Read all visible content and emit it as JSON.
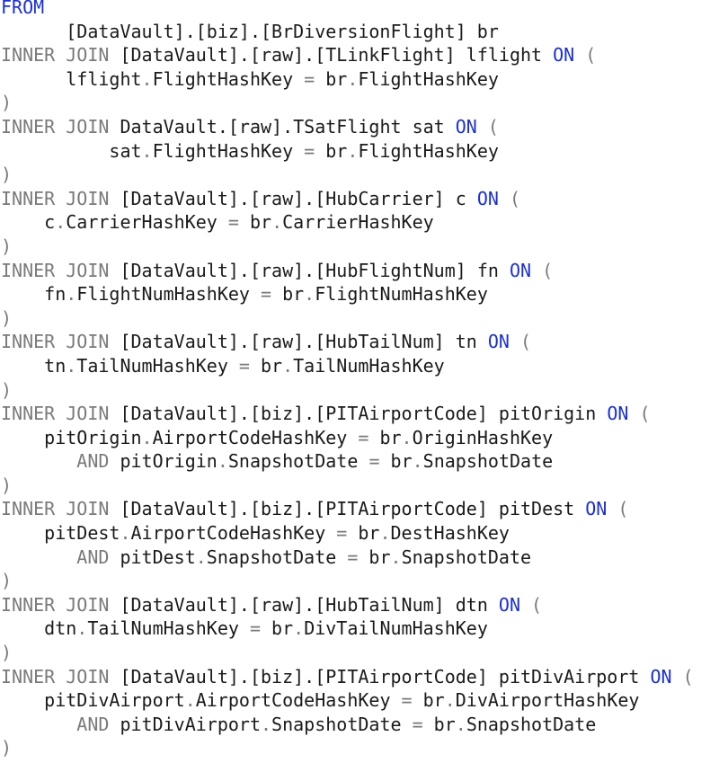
{
  "colors": {
    "keyword": "#1a2fd8",
    "join": "#7a7a7a",
    "operator": "#7a7a7a",
    "identifier": "#1a1a1a",
    "background": "#ffffff"
  },
  "code": {
    "lines": [
      [
        {
          "t": "FROM",
          "k": "keyword"
        }
      ],
      [
        {
          "t": "      [DataVault].[biz].[BrDiversionFlight] br",
          "k": "ident"
        }
      ],
      [
        {
          "t": "INNER JOIN",
          "k": "join"
        },
        {
          "t": " [DataVault].[raw].[TLinkFlight] lflight ",
          "k": "ident"
        },
        {
          "t": "ON",
          "k": "keyword"
        },
        {
          "t": " (",
          "k": "punct"
        }
      ],
      [
        {
          "t": "      lflight",
          "k": "ident"
        },
        {
          "t": ".",
          "k": "punct"
        },
        {
          "t": "FlightHashKey ",
          "k": "ident"
        },
        {
          "t": "=",
          "k": "operator"
        },
        {
          "t": " br",
          "k": "ident"
        },
        {
          "t": ".",
          "k": "punct"
        },
        {
          "t": "FlightHashKey",
          "k": "ident"
        }
      ],
      [
        {
          "t": ")",
          "k": "punct"
        }
      ],
      [
        {
          "t": "INNER JOIN",
          "k": "join"
        },
        {
          "t": " DataVault.[raw].TSatFlight sat ",
          "k": "ident"
        },
        {
          "t": "ON",
          "k": "keyword"
        },
        {
          "t": " (",
          "k": "punct"
        }
      ],
      [
        {
          "t": "          sat",
          "k": "ident"
        },
        {
          "t": ".",
          "k": "punct"
        },
        {
          "t": "FlightHashKey ",
          "k": "ident"
        },
        {
          "t": "=",
          "k": "operator"
        },
        {
          "t": " br",
          "k": "ident"
        },
        {
          "t": ".",
          "k": "punct"
        },
        {
          "t": "FlightHashKey",
          "k": "ident"
        }
      ],
      [
        {
          "t": ")",
          "k": "punct"
        }
      ],
      [
        {
          "t": "INNER JOIN",
          "k": "join"
        },
        {
          "t": " [DataVault].[raw].[HubCarrier] c ",
          "k": "ident"
        },
        {
          "t": "ON",
          "k": "keyword"
        },
        {
          "t": " (",
          "k": "punct"
        }
      ],
      [
        {
          "t": "    c",
          "k": "ident"
        },
        {
          "t": ".",
          "k": "punct"
        },
        {
          "t": "CarrierHashKey ",
          "k": "ident"
        },
        {
          "t": "=",
          "k": "operator"
        },
        {
          "t": " br",
          "k": "ident"
        },
        {
          "t": ".",
          "k": "punct"
        },
        {
          "t": "CarrierHashKey",
          "k": "ident"
        }
      ],
      [
        {
          "t": ")",
          "k": "punct"
        }
      ],
      [
        {
          "t": "INNER JOIN",
          "k": "join"
        },
        {
          "t": " [DataVault].[raw].[HubFlightNum] fn ",
          "k": "ident"
        },
        {
          "t": "ON",
          "k": "keyword"
        },
        {
          "t": " (",
          "k": "punct"
        }
      ],
      [
        {
          "t": "    fn",
          "k": "ident"
        },
        {
          "t": ".",
          "k": "punct"
        },
        {
          "t": "FlightNumHashKey ",
          "k": "ident"
        },
        {
          "t": "=",
          "k": "operator"
        },
        {
          "t": " br",
          "k": "ident"
        },
        {
          "t": ".",
          "k": "punct"
        },
        {
          "t": "FlightNumHashKey",
          "k": "ident"
        }
      ],
      [
        {
          "t": ")",
          "k": "punct"
        }
      ],
      [
        {
          "t": "INNER JOIN",
          "k": "join"
        },
        {
          "t": " [DataVault].[raw].[HubTailNum] tn ",
          "k": "ident"
        },
        {
          "t": "ON",
          "k": "keyword"
        },
        {
          "t": " (",
          "k": "punct"
        }
      ],
      [
        {
          "t": "    tn",
          "k": "ident"
        },
        {
          "t": ".",
          "k": "punct"
        },
        {
          "t": "TailNumHashKey ",
          "k": "ident"
        },
        {
          "t": "=",
          "k": "operator"
        },
        {
          "t": " br",
          "k": "ident"
        },
        {
          "t": ".",
          "k": "punct"
        },
        {
          "t": "TailNumHashKey",
          "k": "ident"
        }
      ],
      [
        {
          "t": ")",
          "k": "punct"
        }
      ],
      [
        {
          "t": "INNER JOIN",
          "k": "join"
        },
        {
          "t": " [DataVault].[biz].[PITAirportCode] pitOrigin ",
          "k": "ident"
        },
        {
          "t": "ON",
          "k": "keyword"
        },
        {
          "t": " (",
          "k": "punct"
        }
      ],
      [
        {
          "t": "    pitOrigin",
          "k": "ident"
        },
        {
          "t": ".",
          "k": "punct"
        },
        {
          "t": "AirportCodeHashKey ",
          "k": "ident"
        },
        {
          "t": "=",
          "k": "operator"
        },
        {
          "t": " br",
          "k": "ident"
        },
        {
          "t": ".",
          "k": "punct"
        },
        {
          "t": "OriginHashKey",
          "k": "ident"
        }
      ],
      [
        {
          "t": "       ",
          "k": "ident"
        },
        {
          "t": "AND",
          "k": "join"
        },
        {
          "t": " pitOrigin",
          "k": "ident"
        },
        {
          "t": ".",
          "k": "punct"
        },
        {
          "t": "SnapshotDate ",
          "k": "ident"
        },
        {
          "t": "=",
          "k": "operator"
        },
        {
          "t": " br",
          "k": "ident"
        },
        {
          "t": ".",
          "k": "punct"
        },
        {
          "t": "SnapshotDate",
          "k": "ident"
        }
      ],
      [
        {
          "t": ")",
          "k": "punct"
        }
      ],
      [
        {
          "t": "INNER JOIN",
          "k": "join"
        },
        {
          "t": " [DataVault].[biz].[PITAirportCode] pitDest ",
          "k": "ident"
        },
        {
          "t": "ON",
          "k": "keyword"
        },
        {
          "t": " (",
          "k": "punct"
        }
      ],
      [
        {
          "t": "    pitDest",
          "k": "ident"
        },
        {
          "t": ".",
          "k": "punct"
        },
        {
          "t": "AirportCodeHashKey ",
          "k": "ident"
        },
        {
          "t": "=",
          "k": "operator"
        },
        {
          "t": " br",
          "k": "ident"
        },
        {
          "t": ".",
          "k": "punct"
        },
        {
          "t": "DestHashKey",
          "k": "ident"
        }
      ],
      [
        {
          "t": "       ",
          "k": "ident"
        },
        {
          "t": "AND",
          "k": "join"
        },
        {
          "t": " pitDest",
          "k": "ident"
        },
        {
          "t": ".",
          "k": "punct"
        },
        {
          "t": "SnapshotDate ",
          "k": "ident"
        },
        {
          "t": "=",
          "k": "operator"
        },
        {
          "t": " br",
          "k": "ident"
        },
        {
          "t": ".",
          "k": "punct"
        },
        {
          "t": "SnapshotDate",
          "k": "ident"
        }
      ],
      [
        {
          "t": ")",
          "k": "punct"
        }
      ],
      [
        {
          "t": "INNER JOIN",
          "k": "join"
        },
        {
          "t": " [DataVault].[raw].[HubTailNum] dtn ",
          "k": "ident"
        },
        {
          "t": "ON",
          "k": "keyword"
        },
        {
          "t": " (",
          "k": "punct"
        }
      ],
      [
        {
          "t": "    dtn",
          "k": "ident"
        },
        {
          "t": ".",
          "k": "punct"
        },
        {
          "t": "TailNumHashKey ",
          "k": "ident"
        },
        {
          "t": "=",
          "k": "operator"
        },
        {
          "t": " br",
          "k": "ident"
        },
        {
          "t": ".",
          "k": "punct"
        },
        {
          "t": "DivTailNumHashKey",
          "k": "ident"
        }
      ],
      [
        {
          "t": ")",
          "k": "punct"
        }
      ],
      [
        {
          "t": "INNER JOIN",
          "k": "join"
        },
        {
          "t": " [DataVault].[biz].[PITAirportCode] pitDivAirport ",
          "k": "ident"
        },
        {
          "t": "ON",
          "k": "keyword"
        },
        {
          "t": " (",
          "k": "punct"
        }
      ],
      [
        {
          "t": "    pitDivAirport",
          "k": "ident"
        },
        {
          "t": ".",
          "k": "punct"
        },
        {
          "t": "AirportCodeHashKey ",
          "k": "ident"
        },
        {
          "t": "=",
          "k": "operator"
        },
        {
          "t": " br",
          "k": "ident"
        },
        {
          "t": ".",
          "k": "punct"
        },
        {
          "t": "DivAirportHashKey",
          "k": "ident"
        }
      ],
      [
        {
          "t": "       ",
          "k": "ident"
        },
        {
          "t": "AND",
          "k": "join"
        },
        {
          "t": " pitDivAirport",
          "k": "ident"
        },
        {
          "t": ".",
          "k": "punct"
        },
        {
          "t": "SnapshotDate ",
          "k": "ident"
        },
        {
          "t": "=",
          "k": "operator"
        },
        {
          "t": " br",
          "k": "ident"
        },
        {
          "t": ".",
          "k": "punct"
        },
        {
          "t": "SnapshotDate",
          "k": "ident"
        }
      ],
      [
        {
          "t": ")",
          "k": "punct"
        }
      ]
    ]
  }
}
